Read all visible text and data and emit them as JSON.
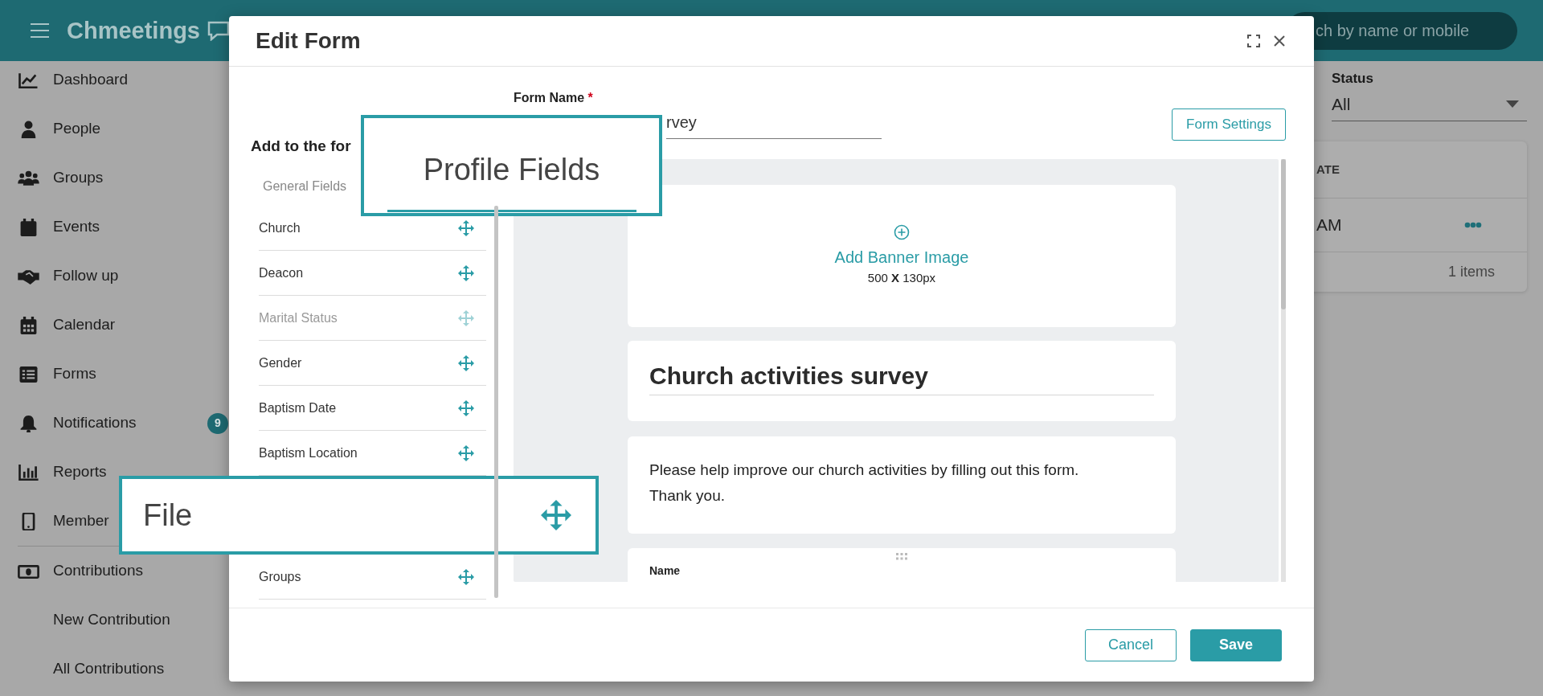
{
  "app_header": {
    "logo": "Chmeetings",
    "search": {
      "placeholder": "ch by name or mobile"
    }
  },
  "sidebar": {
    "sections": [
      [
        {
          "label": "Dashboard"
        },
        {
          "label": "People"
        },
        {
          "label": "Groups"
        },
        {
          "label": "Events"
        },
        {
          "label": "Follow up"
        },
        {
          "label": "Calendar"
        },
        {
          "label": "Forms"
        },
        {
          "label": "Notifications",
          "badge": "9"
        },
        {
          "label": "Reports"
        },
        {
          "label": "Member"
        }
      ],
      [
        {
          "label": "Contributions",
          "children": [
            {
              "label": "New Contribution"
            },
            {
              "label": "All Contributions"
            }
          ]
        }
      ]
    ]
  },
  "filters": {
    "status": {
      "label": "Status",
      "value": "All"
    }
  },
  "table": {
    "columns": [
      "ATE"
    ],
    "rows": [
      {
        "cell": "AM"
      }
    ],
    "footer": "1 items"
  },
  "modal": {
    "title": "Edit Form",
    "palette": {
      "heading": "Add to the for",
      "tabs": [
        {
          "label": "General Fields",
          "selected": false,
          "kind": "tab"
        },
        {
          "label": "Profile Fields",
          "selected": true,
          "kind": "callout"
        }
      ],
      "fields": [
        {
          "label": "Church",
          "disabled": false,
          "kind": "row"
        },
        {
          "label": "Deacon",
          "disabled": false,
          "kind": "row"
        },
        {
          "label": "Marital Status",
          "disabled": true,
          "kind": "row"
        },
        {
          "label": "Gender",
          "disabled": false,
          "kind": "row"
        },
        {
          "label": "Baptism Date",
          "disabled": false,
          "kind": "row"
        },
        {
          "label": "Baptism Location",
          "disabled": false,
          "kind": "row"
        },
        {
          "label": "File",
          "disabled": false,
          "kind": "callout"
        },
        {
          "label": "Groups",
          "disabled": false,
          "kind": "row"
        }
      ]
    },
    "form_name": {
      "label": "Form Name",
      "required_mark": "*",
      "value": "rvey"
    },
    "settings_button": "Form Settings",
    "banner": {
      "action": "Add Banner Image",
      "size": "500 **X** 130px"
    },
    "form_title": "Church activities survey",
    "description": "Please help improve our church activities by filling out this form. Thank you.",
    "first_field": {
      "label": "Name"
    },
    "buttons": [
      {
        "label": "Cancel",
        "kind": "outline"
      },
      {
        "label": "Save",
        "kind": "primary"
      }
    ]
  }
}
